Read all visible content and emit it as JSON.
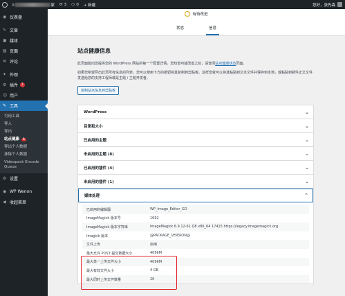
{
  "adminbar": {
    "site_suffix": "家",
    "comments": "3",
    "pending": "0",
    "new": "+ 新建",
    "greeting": "您好，张先森"
  },
  "sidebar": {
    "items": [
      {
        "icon": "◉",
        "label": "仪表盘"
      },
      {
        "icon": "✎",
        "label": "文章"
      },
      {
        "icon": "▣",
        "label": "媒体"
      },
      {
        "icon": "▤",
        "label": "页面"
      },
      {
        "icon": "✉",
        "label": "评论"
      },
      {
        "icon": "✦",
        "label": "外观"
      },
      {
        "icon": "⚙",
        "label": "插件",
        "badge": "1"
      },
      {
        "icon": "☺",
        "label": "用户"
      },
      {
        "icon": "✎",
        "label": "工具"
      }
    ],
    "submenu": [
      "可用工具",
      "导入",
      "导出",
      "站点健康",
      "导出个人数据",
      "抹除个人数据",
      "Videopack Encode Queue"
    ],
    "badge_health": "1",
    "bottom": [
      {
        "icon": "⚙",
        "label": "设置"
      },
      {
        "icon": "◉",
        "label": "WP Wenon"
      },
      {
        "icon": "◀",
        "label": "收起菜单"
      }
    ]
  },
  "header": {
    "status": "有待改进",
    "tabs": [
      "状态",
      "信息"
    ]
  },
  "content": {
    "title": "站点健康信息",
    "p1_a": "此页面能向您提供您的 WordPress 网站的每一个配置详情。您知道可能改善之处，请查阅",
    "p1_link": "站点健康状态",
    "p1_b": "页面。",
    "p2": "如果您希望导出此页所有信息的列表，您可以使用下方的按钮将其复制到剪贴板。这样您就可以将其粘贴到文本文件并保存到本地，或粘贴到邮件正文文件发送给您的支持工程师或是主题 / 主题开发者。",
    "copy_button": "复制站点信息到剪贴板"
  },
  "accordion": {
    "rows": [
      "WordPress",
      "目录和大小",
      "已启用的主题",
      "未启用的主题 (8)",
      "已启用的插件 (4)",
      "未启用的插件 (1)"
    ],
    "open": "媒体处理",
    "details": [
      {
        "k": "已启用的编辑器",
        "v": "WP_Image_Editor_GD"
      },
      {
        "k": "ImageMagick 版本号",
        "v": "1692"
      },
      {
        "k": "ImageMagick 版本字符串",
        "v": "ImageMagick 6.9.12-61 Q8 x86_64 17415 https://legacy.imagemagick.org"
      },
      {
        "k": "Imagick 版本",
        "v": "@PACKAGE_VERSION@"
      },
      {
        "k": "文件上传",
        "v": "启用"
      },
      {
        "k": "最大允许 POST 提交数据大小",
        "v": "4096M"
      },
      {
        "k": "最大单一上传文件大小",
        "v": "4096M"
      },
      {
        "k": "最大有效文件大小",
        "v": "4 GB"
      },
      {
        "k": "最大同时上传文件数量",
        "v": "20"
      }
    ]
  }
}
